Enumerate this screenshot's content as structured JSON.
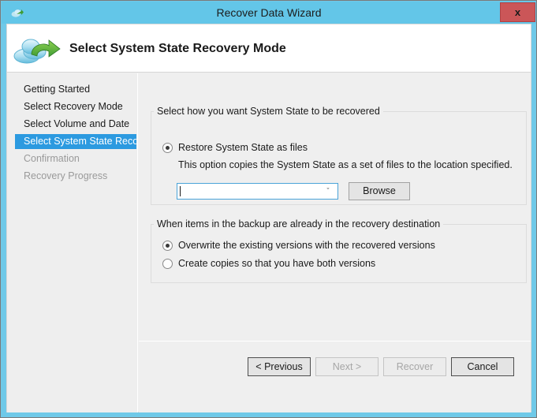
{
  "window": {
    "title": "Recover Data Wizard",
    "titlebar_icon": "cloud-icon",
    "close_label": "x"
  },
  "header": {
    "icon": "cloud-restore-icon",
    "title": "Select System State Recovery Mode"
  },
  "sidebar": {
    "items": [
      {
        "label": "Getting Started",
        "state": "done"
      },
      {
        "label": "Select Recovery Mode",
        "state": "done"
      },
      {
        "label": "Select Volume and Date",
        "state": "done"
      },
      {
        "label": "Select System State Reco...",
        "state": "selected"
      },
      {
        "label": "Confirmation",
        "state": "disabled"
      },
      {
        "label": "Recovery Progress",
        "state": "disabled"
      }
    ],
    "selected_color": "#2c9ae0"
  },
  "main": {
    "group_recover": {
      "legend": "Select how you want System State to be recovered",
      "option_label": "Restore System State as files",
      "option_checked": true,
      "description": "This option copies the System State as a set of files to the location specified.",
      "path_value": "",
      "path_placeholder": "",
      "dropdown_arrow": "ˇ",
      "browse_label": "Browse"
    },
    "group_conflict": {
      "legend": "When items in the backup are already in the recovery destination",
      "options": [
        {
          "label": "Overwrite the existing versions with the recovered versions",
          "checked": true
        },
        {
          "label": "Create copies so that you have both versions",
          "checked": false
        }
      ]
    }
  },
  "footer": {
    "previous_label": "< Previous",
    "next_label": "Next >",
    "recover_label": "Recover",
    "cancel_label": "Cancel"
  }
}
